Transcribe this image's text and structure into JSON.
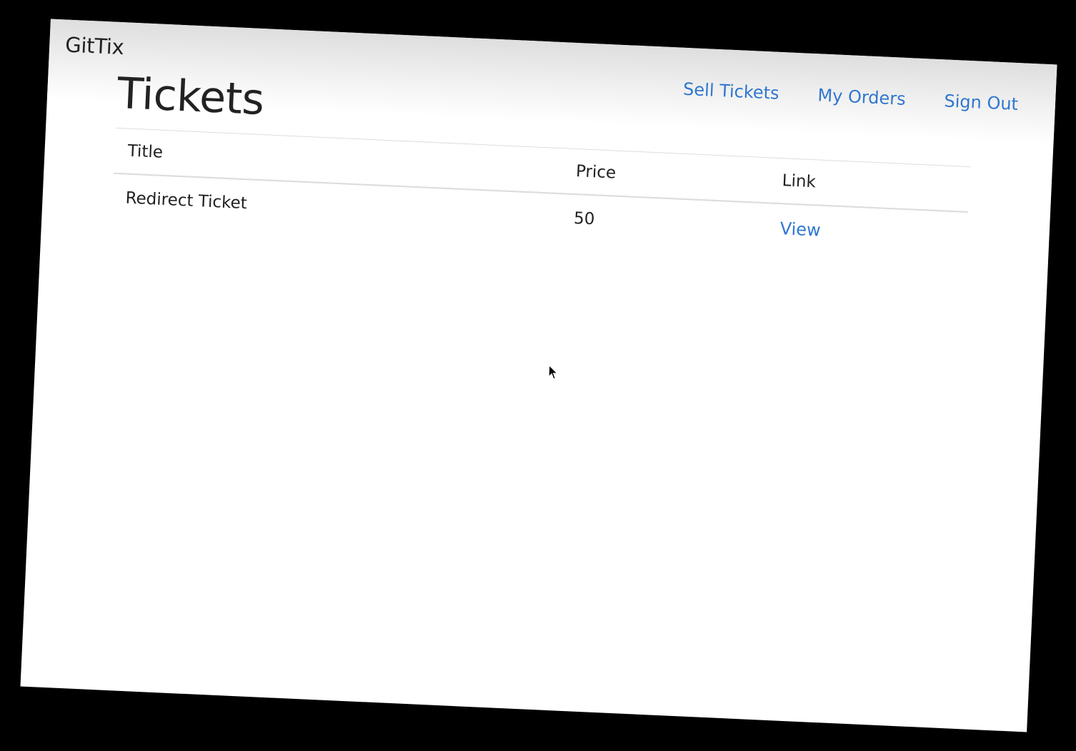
{
  "navbar": {
    "brand": "GitTix",
    "links": [
      {
        "label": "Sell Tickets"
      },
      {
        "label": "My Orders"
      },
      {
        "label": "Sign Out"
      }
    ]
  },
  "main": {
    "heading": "Tickets",
    "table": {
      "columns": [
        "Title",
        "Price",
        "Link"
      ],
      "rows": [
        {
          "title": "Redirect Ticket",
          "price": "50",
          "link": "View"
        }
      ]
    }
  },
  "cursor": {
    "icon": "mouse-pointer-icon"
  },
  "colors": {
    "link": "#2f77cf",
    "text": "#222222",
    "background": "#ffffff"
  }
}
